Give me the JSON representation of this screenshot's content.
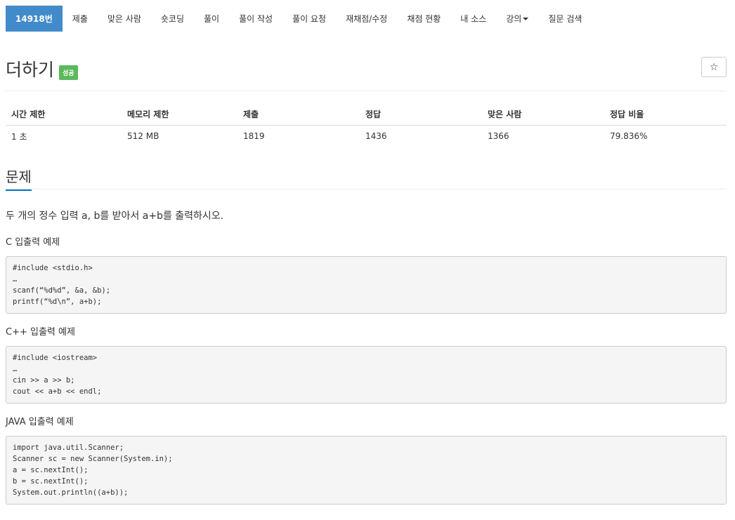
{
  "nav": {
    "items": [
      {
        "label": "14918번",
        "name": "nav-problem-number"
      },
      {
        "label": "제출",
        "name": "nav-submit"
      },
      {
        "label": "맞은 사람",
        "name": "nav-accepted-users"
      },
      {
        "label": "숏코딩",
        "name": "nav-short-coding"
      },
      {
        "label": "풀이",
        "name": "nav-solutions"
      },
      {
        "label": "풀이 작성",
        "name": "nav-write-solution"
      },
      {
        "label": "풀이 요청",
        "name": "nav-request-solution"
      },
      {
        "label": "재채점/수정",
        "name": "nav-rejudge"
      },
      {
        "label": "채점 현황",
        "name": "nav-status"
      },
      {
        "label": "내 소스",
        "name": "nav-my-source"
      },
      {
        "label": "강의",
        "name": "nav-lectures"
      },
      {
        "label": "질문 검색",
        "name": "nav-question-search"
      }
    ]
  },
  "problem": {
    "title": "더하기",
    "badge": "성공",
    "star": "☆"
  },
  "stats": {
    "headers": [
      "시간 제한",
      "메모리 제한",
      "제출",
      "정답",
      "맞은 사람",
      "정답 비율"
    ],
    "values": [
      "1 초",
      "512 MB",
      "1819",
      "1436",
      "1366",
      "79.836%"
    ]
  },
  "section": {
    "heading": "문제",
    "description": "두 개의 정수 입력 a, b를 받아서 a+b를 출력하시오.",
    "c_label": "C 입출력 예제",
    "c_code": "#include <stdio.h>\n…\nscanf(“%d%d”, &a, &b);\nprintf(“%d\\n”, a+b);",
    "cpp_label": "C++ 입출력 예제",
    "cpp_code": "#include <iostream>\n…\ncin >> a >> b;\ncout << a+b << endl;",
    "java_label": "JAVA 입출력 예제",
    "java_code": "import java.util.Scanner;\nScanner sc = new Scanner(System.in);\na = sc.nextInt();\nb = sc.nextInt();\nSystem.out.println((a+b));"
  }
}
